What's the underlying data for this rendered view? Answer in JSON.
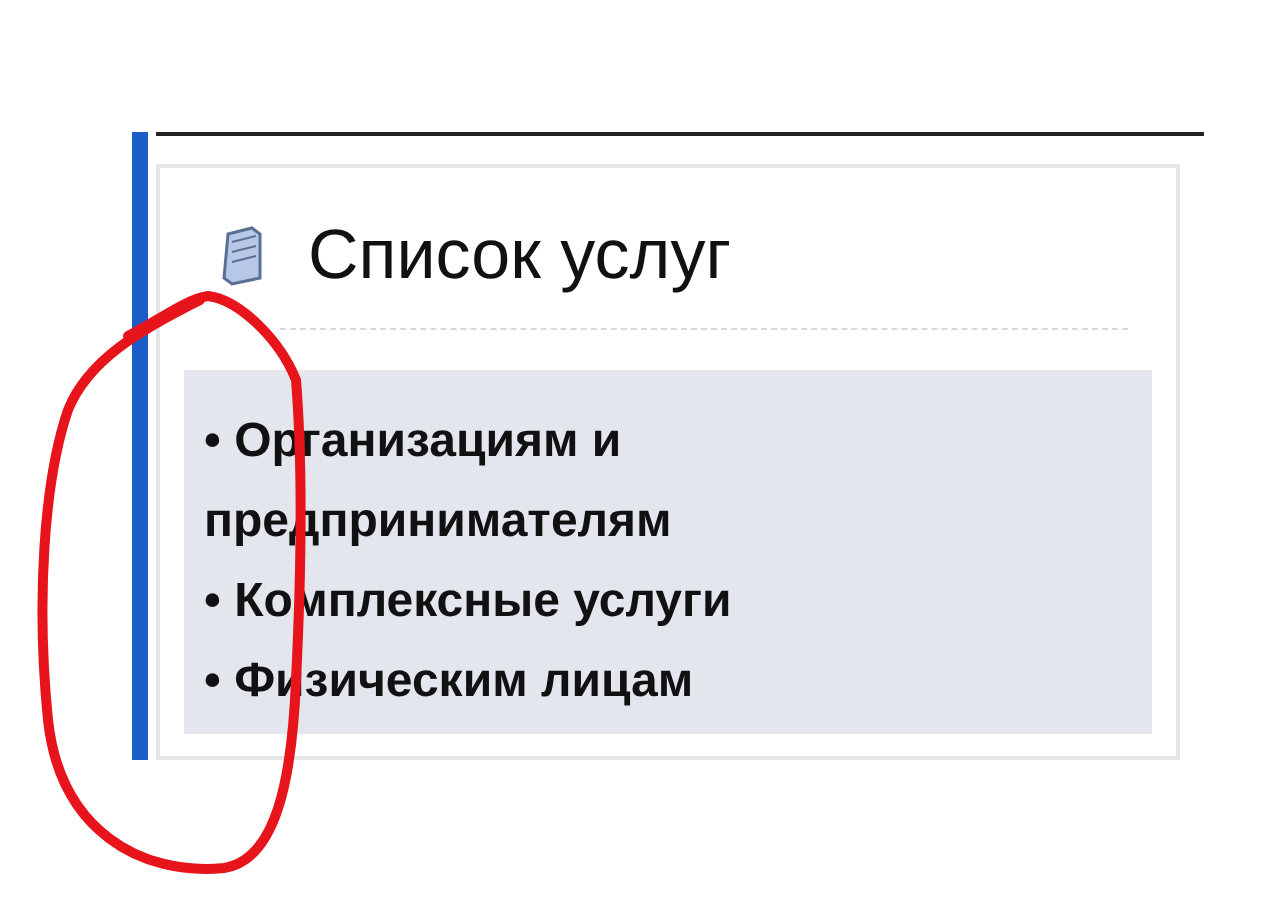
{
  "title": "Список услуг",
  "items": [
    {
      "bullet": "•",
      "text": "Организациям и предпринимателям"
    },
    {
      "bullet": "•",
      "text": "Комплексные услуги"
    },
    {
      "bullet": "•",
      "text": "Физическим лицам"
    }
  ],
  "annotation": {
    "kind": "circle",
    "color": "#e8141c"
  }
}
